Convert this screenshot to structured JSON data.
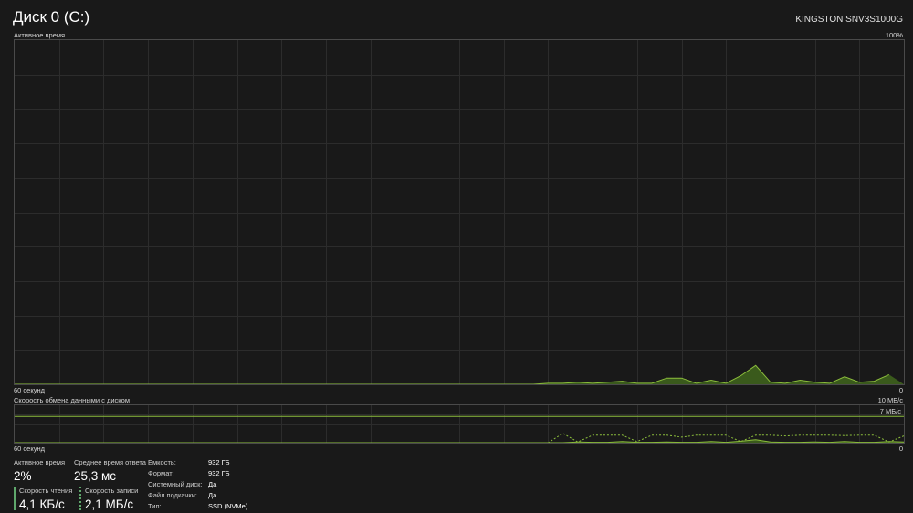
{
  "header": {
    "title": "Диск 0 (C:)",
    "model": "KINGSTON SNV3S1000G"
  },
  "active_chart": {
    "label": "Активное время",
    "max_label": "100%",
    "time_label": "60 секунд",
    "min_label": "0"
  },
  "transfer_chart": {
    "label": "Скорость обмена данными с диском",
    "max_label": "10 МБ/с",
    "line_label": "7 МБ/с",
    "time_label": "60 секунд",
    "min_label": "0"
  },
  "stats": {
    "active_time": {
      "label": "Активное время",
      "value": "2%"
    },
    "response_time": {
      "label": "Среднее время ответа",
      "value": "25,3 мс"
    },
    "read_speed": {
      "label": "Скорость чтения",
      "value": "4,1 КБ/с"
    },
    "write_speed": {
      "label": "Скорость записи",
      "value": "2,1 МБ/с"
    }
  },
  "properties": [
    {
      "label": "Емкость:",
      "value": "932 ГБ"
    },
    {
      "label": "Формат:",
      "value": "932 ГБ"
    },
    {
      "label": "Системный диск:",
      "value": "Да"
    },
    {
      "label": "Файл подкачки:",
      "value": "Да"
    },
    {
      "label": "Тип:",
      "value": "SSD (NVMe)"
    }
  ],
  "colors": {
    "accent": "#8cbe3c",
    "fill": "#3a5a1c",
    "grid": "#2c2c2c",
    "border": "#4a4a4a"
  },
  "chart_data": [
    {
      "type": "area",
      "title": "Активное время",
      "ylabel": "",
      "ylim": [
        0,
        100
      ],
      "x": [
        -60,
        -59,
        -58,
        -57,
        -56,
        -55,
        -54,
        -53,
        -52,
        -51,
        -50,
        -49,
        -48,
        -47,
        -46,
        -45,
        -44,
        -43,
        -42,
        -41,
        -40,
        -39,
        -38,
        -37,
        -36,
        -35,
        -34,
        -33,
        -32,
        -31,
        -30,
        -29,
        -28,
        -27,
        -26,
        -25,
        -24,
        -23,
        -22,
        -21,
        -20,
        -19,
        -18,
        -17,
        -16,
        -15,
        -14,
        -13,
        -12,
        -11,
        -10,
        -9,
        -8,
        -7,
        -6,
        -5,
        -4,
        -3,
        -2,
        -1,
        0
      ],
      "series": [
        {
          "values": [
            0,
            0,
            0,
            0,
            0,
            0,
            0,
            0,
            0,
            0,
            0,
            0,
            0,
            0,
            0,
            0,
            0,
            0,
            0,
            0,
            0,
            0,
            0,
            0,
            0,
            0,
            0,
            0,
            0,
            0,
            0,
            0,
            0,
            0,
            0,
            0,
            0.3,
            0.3,
            0.6,
            0.3,
            0.6,
            0.9,
            0.3,
            0.3,
            1.8,
            1.8,
            0.3,
            1.2,
            0.3,
            2.5,
            5.5,
            0.6,
            0.3,
            1.2,
            0.6,
            0.3,
            2.2,
            0.6,
            0.9,
            2.8
          ]
        }
      ]
    },
    {
      "type": "line",
      "title": "Скорость обмена данными с диском",
      "ylabel": "",
      "ylim": [
        0,
        10
      ],
      "x": [
        -60,
        -59,
        -58,
        -57,
        -56,
        -55,
        -54,
        -53,
        -52,
        -51,
        -50,
        -49,
        -48,
        -47,
        -46,
        -45,
        -44,
        -43,
        -42,
        -41,
        -40,
        -39,
        -38,
        -37,
        -36,
        -35,
        -34,
        -33,
        -32,
        -31,
        -30,
        -29,
        -28,
        -27,
        -26,
        -25,
        -24,
        -23,
        -22,
        -21,
        -20,
        -19,
        -18,
        -17,
        -16,
        -15,
        -14,
        -13,
        -12,
        -11,
        -10,
        -9,
        -8,
        -7,
        -6,
        -5,
        -4,
        -3,
        -2,
        -1,
        0
      ],
      "series": [
        {
          "name": "",
          "values": [
            0,
            0,
            0,
            0,
            0,
            0,
            0,
            0,
            0,
            0,
            0,
            0,
            0,
            0,
            0,
            0,
            0,
            0,
            0,
            0,
            0,
            0,
            0,
            0,
            0,
            0,
            0,
            0,
            0,
            0,
            0,
            0,
            0,
            0,
            0,
            0,
            0,
            0,
            0.2,
            0.1,
            0.1,
            0.3,
            0.1,
            0.1,
            0.2,
            0.1,
            0.1,
            0.3,
            0.1,
            0.4,
            0.8,
            0.2,
            0.1,
            0.1,
            0.2,
            0.1,
            0.3,
            0.1,
            0.1,
            0.3,
            0.2
          ],
          "style": "solid"
        },
        {
          "name": "",
          "values": [
            0,
            0,
            0,
            0,
            0,
            0,
            0,
            0,
            0,
            0,
            0,
            0,
            0,
            0,
            0,
            0,
            0,
            0,
            0,
            0,
            0,
            0,
            0,
            0,
            0,
            0,
            0,
            0,
            0,
            0,
            0,
            0,
            0,
            0,
            0,
            0,
            0,
            2.5,
            0.2,
            2.0,
            2.0,
            2.0,
            0.3,
            2.0,
            2.0,
            1.5,
            2.0,
            2.0,
            2.0,
            0.3,
            2.0,
            2.0,
            1.8,
            2.0,
            2.0,
            2.0,
            1.9,
            2.0,
            2.0,
            0.2,
            1.8
          ],
          "style": "dashed"
        }
      ],
      "reference_line": {
        "value": 7,
        "label": "7 МБ/с"
      }
    }
  ]
}
